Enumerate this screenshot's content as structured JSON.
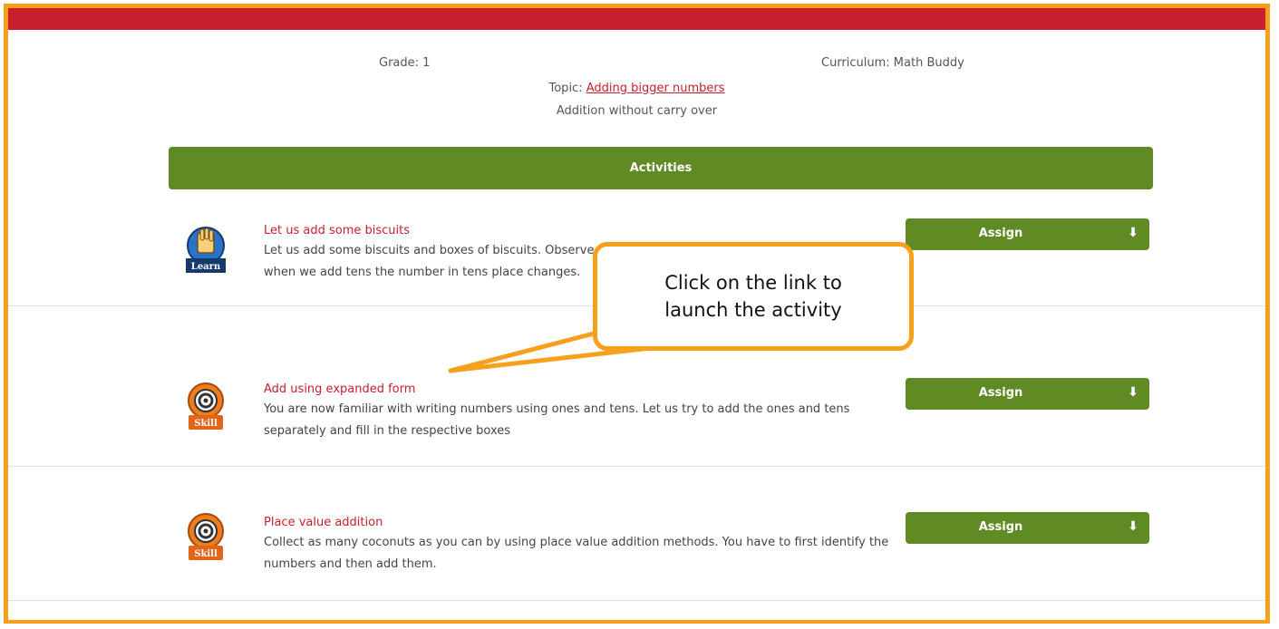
{
  "header": {
    "grade_label": "Grade: 1",
    "curriculum_label": "Curriculum: Math Buddy",
    "topic_prefix": "Topic: ",
    "topic_link": "Adding bigger numbers",
    "subtopic": "Addition without carry over"
  },
  "activities_title": "Activities",
  "activities": [
    {
      "badge": "Learn",
      "icon": "learn-hand-icon",
      "title": "Let us add some biscuits",
      "description": "Let us add some biscuits and boxes of biscuits. Observe how the number in the units place changes and when we add tens the number in tens place changes.",
      "assign_label": "Assign"
    },
    {
      "badge": "Skill",
      "icon": "skill-target-icon",
      "title": "Add using expanded form",
      "description": "You are now familiar with writing numbers using ones and tens. Let us try to add the ones and tens separately and fill in the respective boxes",
      "assign_label": "Assign"
    },
    {
      "badge": "Skill",
      "icon": "skill-target-icon",
      "title": "Place value addition",
      "description": "Collect as many coconuts as you can by using place value addition methods. You have to first identify the numbers and then add them.",
      "assign_label": "Assign"
    }
  ],
  "callout_text": "Click on the link to launch the activity",
  "colors": {
    "accent_red": "#c8202c",
    "green": "#5f8a24",
    "orange": "#f7a01e"
  }
}
